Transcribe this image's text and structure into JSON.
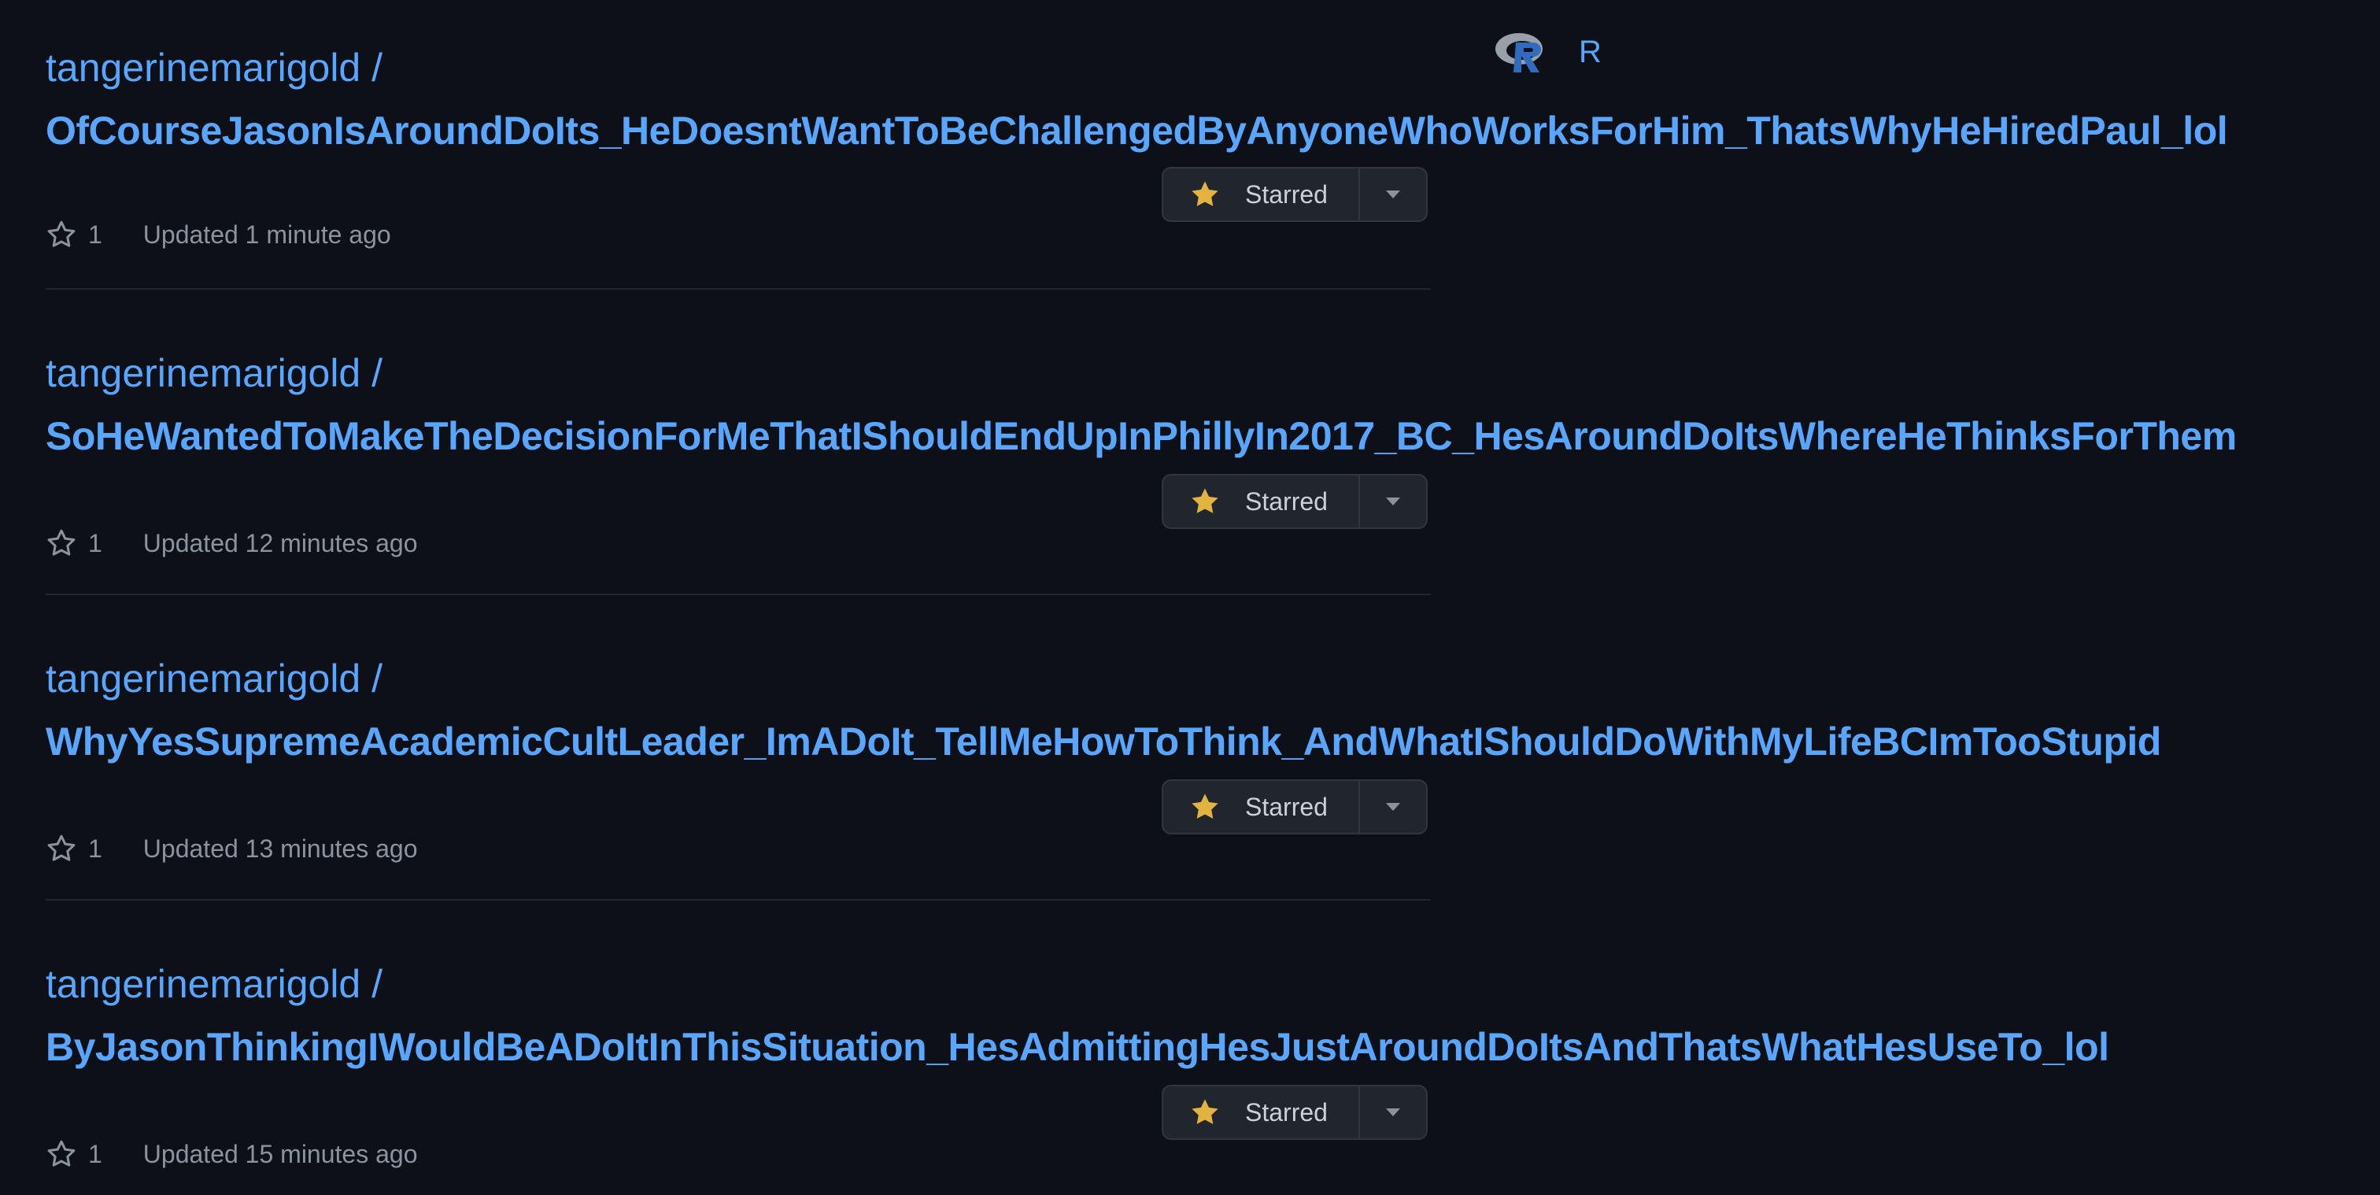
{
  "language": {
    "icon": "r-logo-icon",
    "name": "R"
  },
  "repos": [
    {
      "owner": "tangerinemarigold /",
      "name": "OfCourseJasonIsAroundDoIts_HeDoesntWantToBeChallengedByAnyoneWhoWorksForHim_ThatsWhyHeHiredPaul_lol",
      "stars": "1",
      "updated": "Updated 1 minute ago",
      "star_button_label": "Starred"
    },
    {
      "owner": "tangerinemarigold /",
      "name": "SoHeWantedToMakeTheDecisionForMeThatIShouldEndUpInPhillyIn2017_BC_HesAroundDoItsWhereHeThinksForThem",
      "stars": "1",
      "updated": "Updated 12 minutes ago",
      "star_button_label": "Starred"
    },
    {
      "owner": "tangerinemarigold /",
      "name": "WhyYesSupremeAcademicCultLeader_ImADoIt_TellMeHowToThink_AndWhatIShouldDoWithMyLifeBCImTooStupid",
      "stars": "1",
      "updated": "Updated 13 minutes ago",
      "star_button_label": "Starred"
    },
    {
      "owner": "tangerinemarigold /",
      "name": "ByJasonThinkingIWouldBeADoItInThisSituation_HesAdmittingHesJustAroundDoItsAndThatsWhatHesUseTo_lol",
      "stars": "1",
      "updated": "Updated 15 minutes ago",
      "star_button_label": "Starred"
    }
  ],
  "colors": {
    "background": "#0d1117",
    "link": "#58a6ff",
    "muted_text": "#8b949e",
    "star_filled": "#e3b341",
    "button_bg": "#21262d",
    "button_border": "#30363d"
  }
}
